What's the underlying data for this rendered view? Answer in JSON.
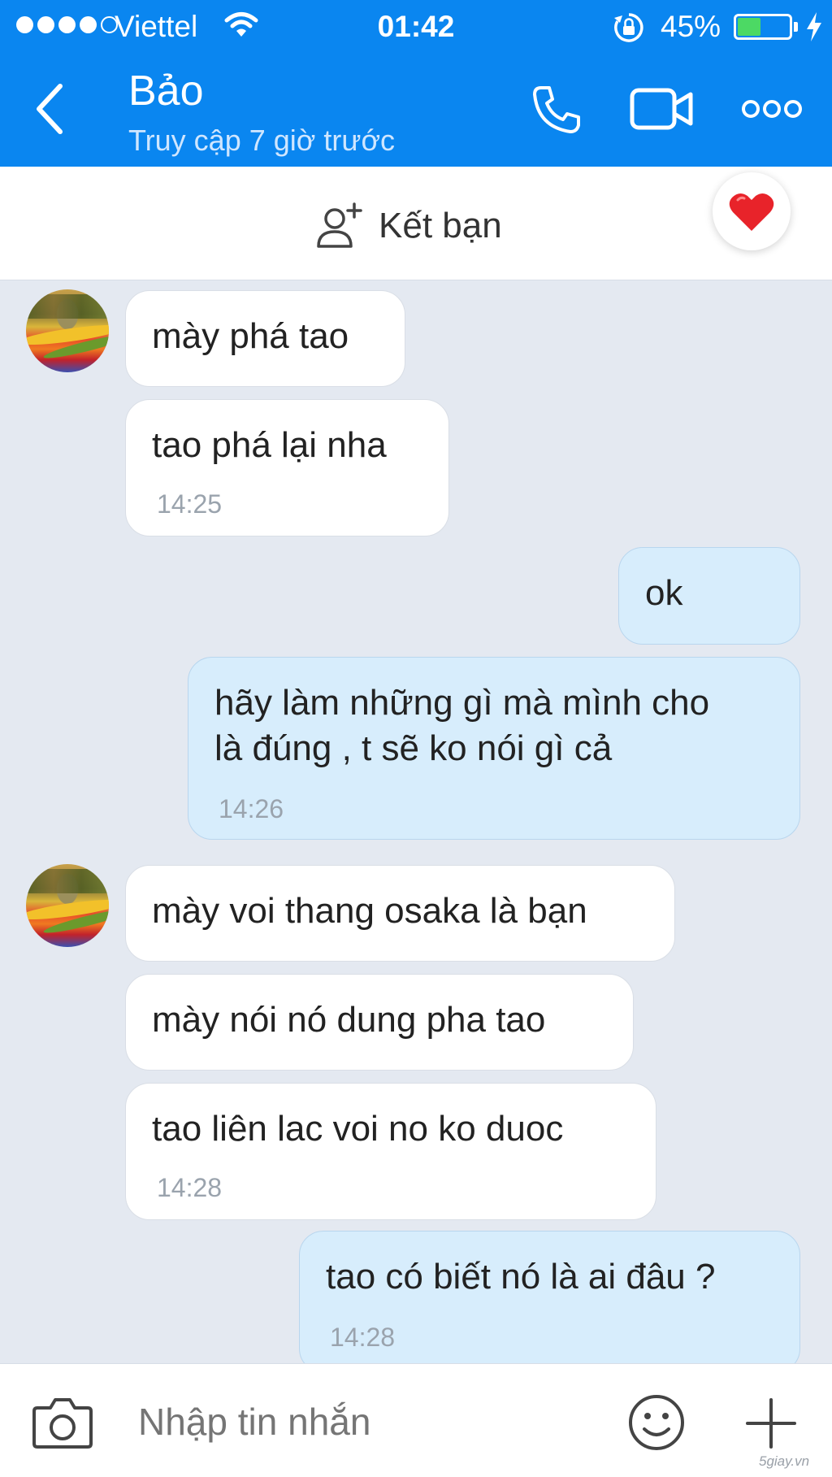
{
  "status_bar": {
    "carrier": "Viettel",
    "time": "01:42",
    "battery_percent": "45%",
    "battery_level": 0.45,
    "signal_bars_filled": 4,
    "signal_bars_total": 5
  },
  "header": {
    "contact_name": "Bảo",
    "last_seen": "Truy cập 7 giờ trước",
    "accent_color": "#0a86f0"
  },
  "friend_bar": {
    "add_friend_label": "Kết bạn"
  },
  "messages": [
    {
      "side": "in",
      "text": "mày phá tao",
      "time": ""
    },
    {
      "side": "in",
      "text": "tao phá lại nha",
      "time": "14:25"
    },
    {
      "side": "out",
      "text": "ok",
      "time": ""
    },
    {
      "side": "out",
      "text": "hãy làm những gì mà mình cho\nlà đúng , t sẽ ko nói gì cả",
      "time": "14:26"
    },
    {
      "side": "in",
      "text": "mày voi thang osaka là bạn",
      "time": ""
    },
    {
      "side": "in",
      "text": "mày nói nó dung pha tao",
      "time": ""
    },
    {
      "side": "in",
      "text": "tao liên lac voi no ko duoc",
      "time": "14:28"
    },
    {
      "side": "out",
      "text": "tao có biết nó là ai đâu ?",
      "time": "14:28"
    }
  ],
  "input": {
    "placeholder": "Nhập tin nhắn"
  },
  "watermark": "5giay.vn"
}
